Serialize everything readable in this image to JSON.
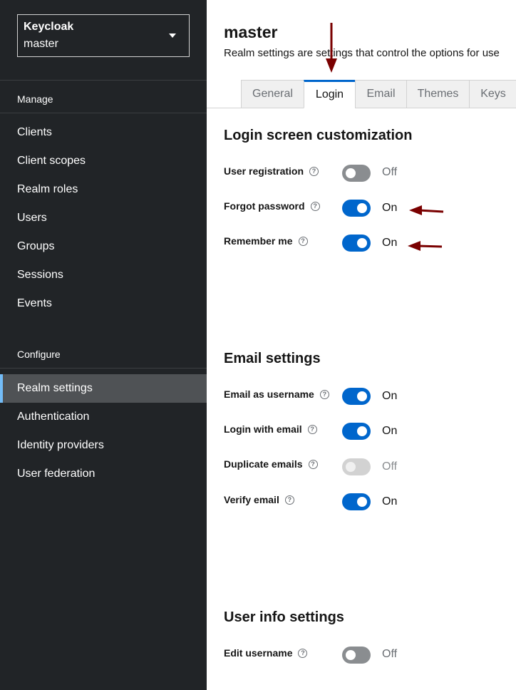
{
  "realm_selector": {
    "app_name": "Keycloak",
    "current_realm": "master"
  },
  "sidebar": {
    "manage_heading": "Manage",
    "manage_items": [
      "Clients",
      "Client scopes",
      "Realm roles",
      "Users",
      "Groups",
      "Sessions",
      "Events"
    ],
    "configure_heading": "Configure",
    "configure_items": [
      "Realm settings",
      "Authentication",
      "Identity providers",
      "User federation"
    ],
    "active_item": "Realm settings"
  },
  "main": {
    "title": "master",
    "description": "Realm settings are settings that control the options for use",
    "tabs": [
      "General",
      "Login",
      "Email",
      "Themes",
      "Keys"
    ],
    "active_tab": "Login"
  },
  "sections": {
    "login": {
      "title": "Login screen customization",
      "fields": [
        {
          "label": "User registration",
          "state": "Off"
        },
        {
          "label": "Forgot password",
          "state": "On"
        },
        {
          "label": "Remember me",
          "state": "On"
        }
      ]
    },
    "email": {
      "title": "Email settings",
      "fields": [
        {
          "label": "Email as username",
          "state": "On"
        },
        {
          "label": "Login with email",
          "state": "On"
        },
        {
          "label": "Duplicate emails",
          "state": "Off"
        },
        {
          "label": "Verify email",
          "state": "On"
        }
      ]
    },
    "user_info": {
      "title": "User info settings",
      "fields": [
        {
          "label": "Edit username",
          "state": "Off"
        }
      ]
    }
  },
  "help_glyph": "?",
  "colors": {
    "accent": "#0066cc",
    "sidebar_bg": "#212427",
    "annotation_arrow": "#7a0000"
  }
}
